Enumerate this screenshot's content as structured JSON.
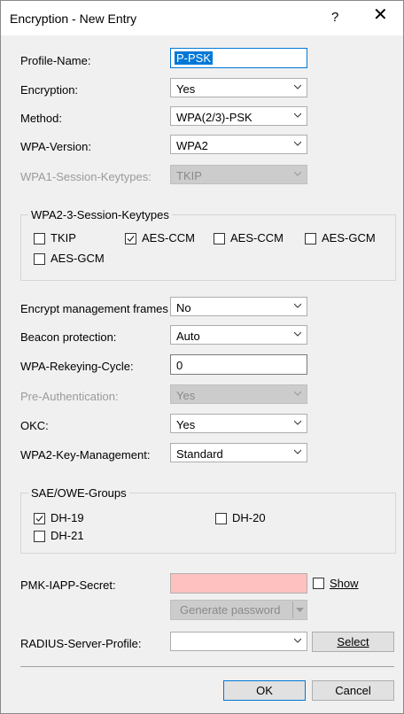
{
  "window": {
    "title": "Encryption - New Entry",
    "help": "?",
    "close": "✕"
  },
  "profile_name": {
    "label": "Profile-Name:",
    "value": "P-PSK"
  },
  "encryption": {
    "label": "Encryption:",
    "value": "Yes"
  },
  "method": {
    "label": "Method:",
    "value": "WPA(2/3)-PSK"
  },
  "wpa_version": {
    "label": "WPA-Version:",
    "value": "WPA2"
  },
  "wpa1_session": {
    "label": "WPA1-Session-Keytypes:",
    "value": "TKIP"
  },
  "wpa23_group": {
    "title": "WPA2-3-Session-Keytypes",
    "items": [
      {
        "label": "TKIP",
        "checked": false
      },
      {
        "label": "AES-CCM",
        "checked": true
      },
      {
        "label": "AES-CCM",
        "checked": false
      },
      {
        "label": "AES-GCM",
        "checked": false
      },
      {
        "label": "AES-GCM",
        "checked": false
      }
    ]
  },
  "enc_mgmt": {
    "label": "Encrypt management frames",
    "value": "No"
  },
  "beacon": {
    "label": "Beacon protection:",
    "value": "Auto"
  },
  "rekey": {
    "label": "WPA-Rekeying-Cycle:",
    "value": "0"
  },
  "preauth": {
    "label": "Pre-Authentication:",
    "value": "Yes"
  },
  "okc": {
    "label": "OKC:",
    "value": "Yes"
  },
  "wpa2_km": {
    "label": "WPA2-Key-Management:",
    "value": "Standard"
  },
  "sae_group": {
    "title": "SAE/OWE-Groups",
    "items": [
      {
        "label": "DH-19",
        "checked": true
      },
      {
        "label": "DH-20",
        "checked": false
      },
      {
        "label": "DH-21",
        "checked": false
      }
    ]
  },
  "pmk": {
    "label": "PMK-IAPP-Secret:",
    "value": "",
    "show_label": "Show",
    "generate_label": "Generate password"
  },
  "radius": {
    "label": "RADIUS-Server-Profile:",
    "value": "",
    "select_label": "Select"
  },
  "buttons": {
    "ok": "OK",
    "cancel": "Cancel"
  },
  "colors": {
    "secret_bg": "#ffc0c0",
    "selection": "#0078d7"
  }
}
